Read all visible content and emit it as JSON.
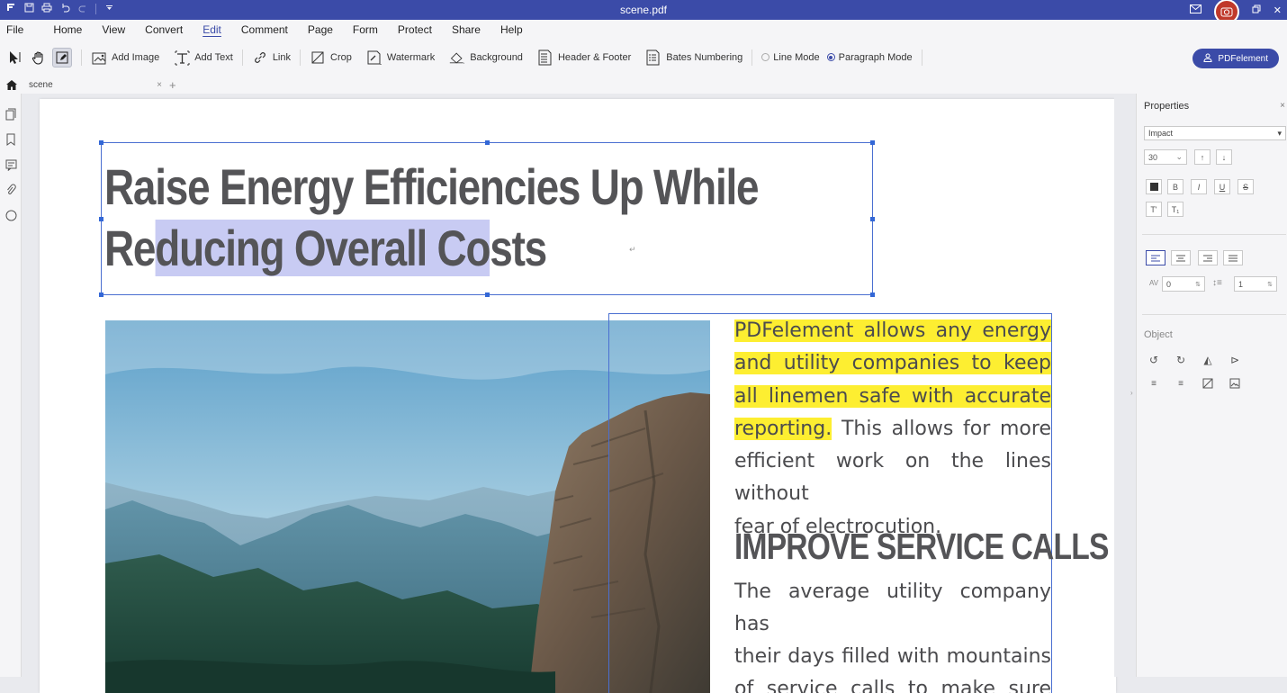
{
  "app": {
    "window_title": "scene.pdf",
    "quick_access": [
      "app-menu-icon",
      "save-icon",
      "print-icon",
      "undo-icon",
      "redo-icon",
      "dropdown-icon"
    ]
  },
  "menu": {
    "items": [
      "File",
      "Home",
      "View",
      "Convert",
      "Edit",
      "Comment",
      "Page",
      "Form",
      "Protect",
      "Share",
      "Help"
    ],
    "active": "Edit"
  },
  "toolbar": {
    "add_image": "Add Image",
    "add_text": "Add Text",
    "link": "Link",
    "crop": "Crop",
    "watermark": "Watermark",
    "background": "Background",
    "header_footer": "Header & Footer",
    "bates_numbering": "Bates Numbering",
    "line_mode": "Line Mode",
    "paragraph_mode": "Paragraph Mode",
    "selected_mode": "Paragraph Mode",
    "pdfelement_button": "PDFelement"
  },
  "tabs": {
    "document_tab": "scene",
    "close": "×",
    "new_tab": "+"
  },
  "document": {
    "headline_line1": "Raise Energy Efficiencies Up While",
    "headline_line2_a": "Re",
    "headline_line2_b": "ducing Overall Co",
    "headline_line2_c": "sts",
    "para1_hl1": "PDFelement allows any energy",
    "para1_hl2": "and utility companies to keep",
    "para1_hl3": "all linemen safe with accurate",
    "para1_hl4": "reporting.",
    "para1_rest1": " This allows for more",
    "para1_rest2": "efficient work on the lines without",
    "para1_rest3": "fear of electrocution.",
    "subheading": "IMPROVE SERVICE CALLS",
    "para2_line1": "The average utility company has",
    "para2_line2": "their days filled with mountains",
    "para2_line3": "of service calls to make sure",
    "highlight_color": "#fdee31",
    "selection_color": "#c8cbf3"
  },
  "properties": {
    "title": "Properties",
    "font": "Impact",
    "font_size": "30",
    "char_spacing": "0",
    "line_spacing": "1",
    "object_label": "Object"
  }
}
